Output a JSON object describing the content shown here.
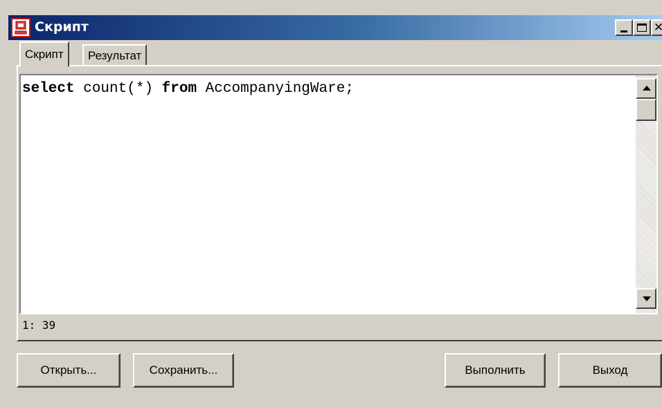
{
  "window": {
    "title": "Скрипт"
  },
  "tabs": [
    {
      "label": "Скрипт",
      "active": true
    },
    {
      "label": "Результат",
      "active": false
    }
  ],
  "editor": {
    "code_keyword_1": "select",
    "code_function": " count(*) ",
    "code_keyword_2": "from",
    "code_rest": " AccompanyingWare;"
  },
  "status": {
    "cursor_position": "1: 39"
  },
  "buttons": {
    "open": "Открыть...",
    "save": "Сохранить...",
    "run": "Выполнить",
    "exit": "Выход"
  },
  "icons": {
    "app": "database-script-icon",
    "minimize": "minimize-icon",
    "maximize": "maximize-icon",
    "close": "close-icon"
  },
  "colors": {
    "titlebar_start": "#0a246a",
    "titlebar_end": "#a6caf0",
    "face": "#d4d0c8"
  }
}
